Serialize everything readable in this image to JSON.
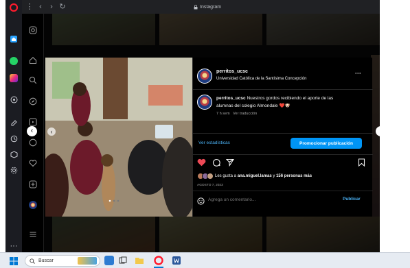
{
  "browser": {
    "address": "Instagram",
    "sidebar_icons": [
      "opera-logo-icon",
      "home-icon",
      "whatsapp-icon",
      "instagram-icon",
      "player-icon",
      "edit-icon",
      "history-icon",
      "box-icon",
      "settings-icon",
      "more-icon"
    ]
  },
  "instagram_nav": [
    "instagram-logo-icon",
    "home-icon",
    "search-icon",
    "explore-icon",
    "reels-icon",
    "messages-icon",
    "notifications-icon",
    "create-icon",
    "profile-icon",
    "menu-icon"
  ],
  "post": {
    "username": "perritos_ucsc",
    "location": "Universidad Católica de la Santísima Concepción",
    "more": "···",
    "caption_user": "perritos_ucsc",
    "caption_line1": "Nuestros gordos recibiendo el aporte de las",
    "caption_line2": "alumnas del colegio Almondale",
    "caption_emoji": "❤️🐶",
    "time_ago": "7 h sem",
    "see_translation": "Ver traducción",
    "view_insights": "Ver estadísticas",
    "promote": "Promocionar publicación",
    "likes_prefix": "Les gusta a",
    "likes_user": "ana.miguel.lamas",
    "likes_mid": "y",
    "likes_count": "156 personas más",
    "date": "AGOSTO 7, 2023",
    "comment_placeholder": "Agrega un comentario...",
    "publish": "Publicar"
  },
  "taskbar": {
    "search_label": "Buscar",
    "apps": [
      "widgets-icon",
      "task-view-icon",
      "file-explorer-icon",
      "opera-icon",
      "word-icon"
    ]
  },
  "colors": {
    "accent": "#0095f6",
    "like": "#ed4956",
    "opera": "#ff1b2d"
  }
}
